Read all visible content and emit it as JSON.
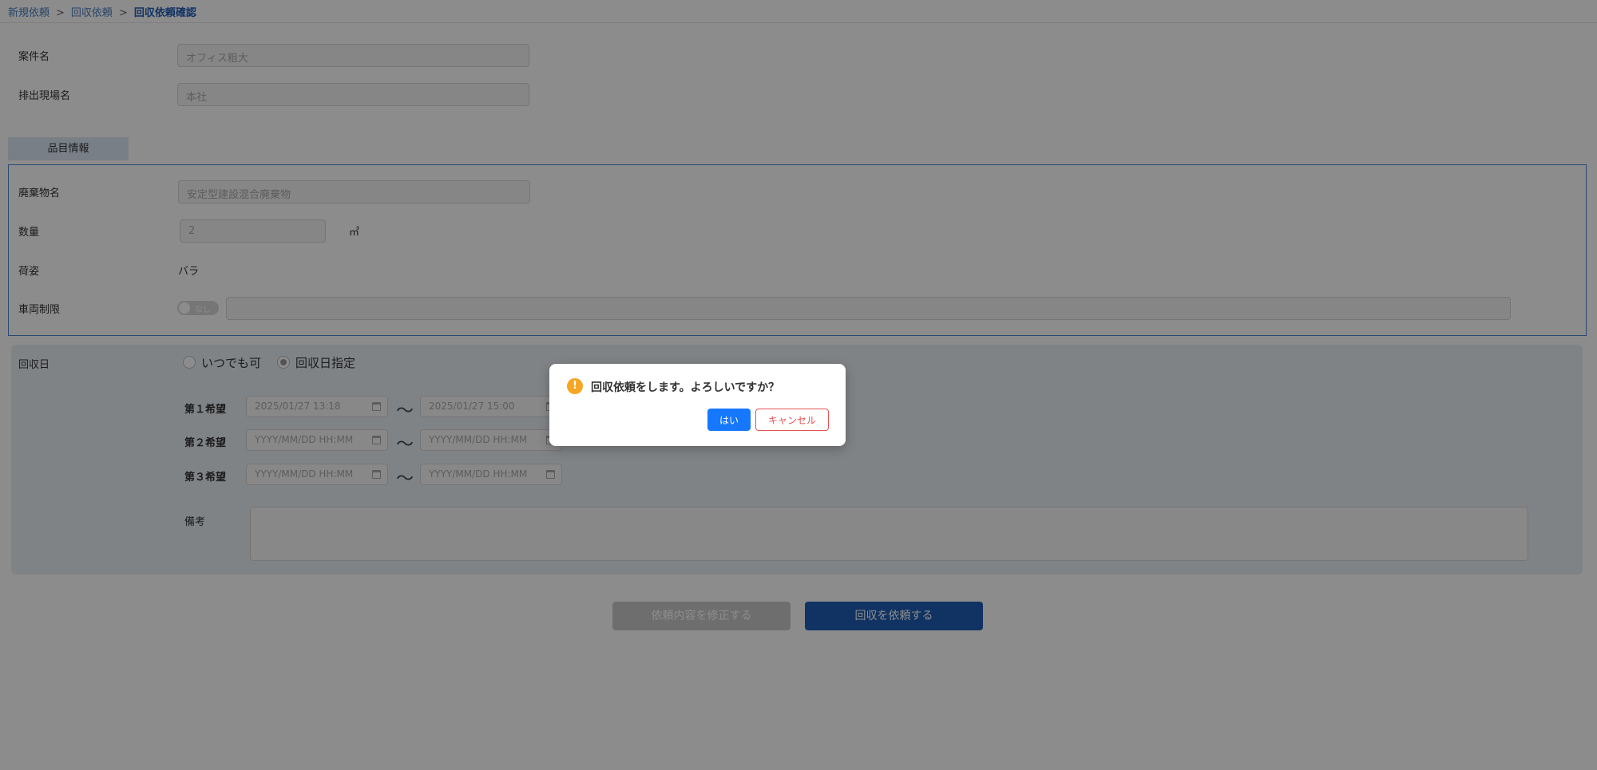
{
  "breadcrumb": {
    "items": [
      "新規依頼",
      "回収依頼"
    ],
    "separator": ">",
    "current": "回収依頼確認"
  },
  "form": {
    "case_name": {
      "label": "案件名",
      "value": "オフィス粗大"
    },
    "site_name": {
      "label": "排出現場名",
      "value": "本社"
    }
  },
  "item_section": {
    "tab_label": "品目情報",
    "waste_name": {
      "label": "廃棄物名",
      "value": "安定型建設混合廃棄物"
    },
    "quantity": {
      "label": "数量",
      "value": "2",
      "unit": "㎥"
    },
    "packing": {
      "label": "荷姿",
      "value": "バラ"
    },
    "vehicle_limit": {
      "label": "車両制限",
      "toggle_text": "なし",
      "value": ""
    }
  },
  "collection": {
    "label": "回収日",
    "options": [
      "いつでも可",
      "回収日指定"
    ],
    "selected": "回収日指定",
    "wishes": [
      {
        "label": "第１希望",
        "from": "2025/01/27 13:18",
        "to": "2025/01/27 15:00"
      },
      {
        "label": "第２希望",
        "from": "YYYY/MM/DD HH:MM",
        "to": "YYYY/MM/DD HH:MM"
      },
      {
        "label": "第３希望",
        "from": "YYYY/MM/DD HH:MM",
        "to": "YYYY/MM/DD HH:MM"
      }
    ],
    "tilde": "〜",
    "remarks_label": "備考"
  },
  "actions": {
    "edit_label": "依頼内容を修正する",
    "submit_label": "回収を依頼する"
  },
  "modal": {
    "icon_glyph": "!",
    "message": "回収依頼をします。よろしいですか？",
    "yes_label": "はい",
    "cancel_label": "キャンセル"
  },
  "colors": {
    "primary": "#1f5db5",
    "accent": "#1677ff",
    "danger": "#e55353",
    "warning": "#f5a623"
  }
}
